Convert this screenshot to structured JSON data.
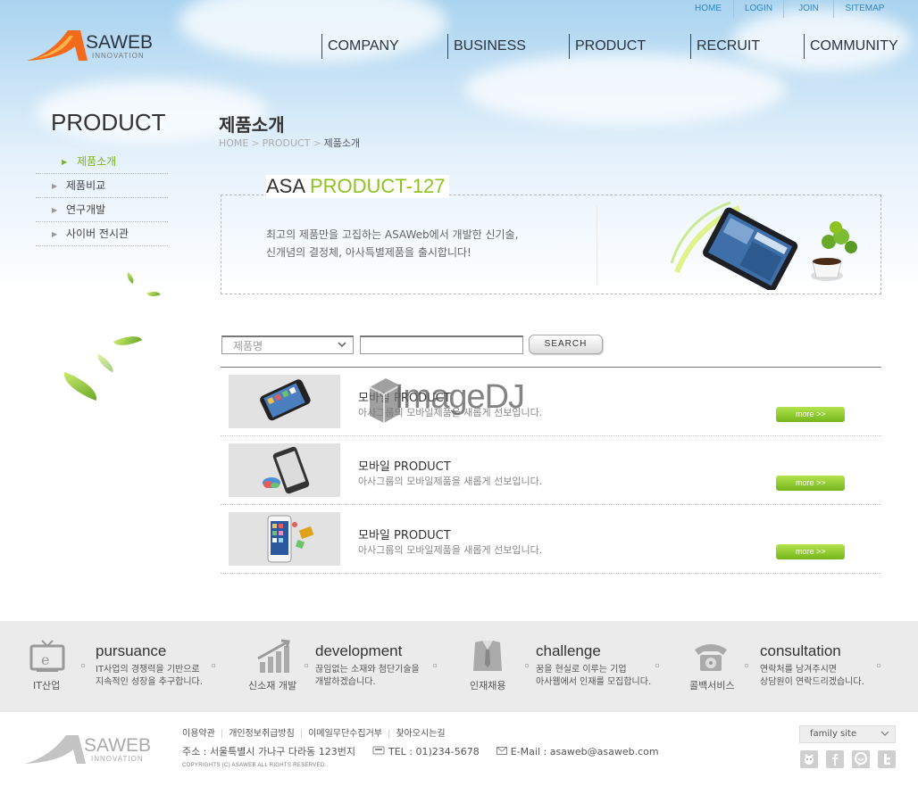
{
  "topnav": {
    "home": "HOME",
    "login": "LOGIN",
    "join": "JOIN",
    "sitemap": "SITEMAP"
  },
  "logo": {
    "brand": "SAWEB",
    "sub": "INNOVATION"
  },
  "mainnav": {
    "company": "COMPANY",
    "business": "BUSINESS",
    "product": "PRODUCT",
    "recruit": "RECRUIT",
    "community": "COMMUNITY"
  },
  "sidebar": {
    "title": "PRODUCT",
    "items": [
      {
        "label": "제품소개"
      },
      {
        "label": "제품비교"
      },
      {
        "label": "연구개발"
      },
      {
        "label": "사이버 전시관"
      }
    ]
  },
  "page": {
    "title": "제품소개",
    "breadcrumb": {
      "home": "HOME",
      "section": "PRODUCT",
      "current": "제품소개"
    }
  },
  "promo": {
    "title_a": "ASA",
    "title_b": "PRODUCT-127",
    "line1": "최고의 제품만을 고집하는 ASAWeb에서 개발한 신기술,",
    "line2": "신개념의 결정체, 아사특별제품을 출시합니다!"
  },
  "search": {
    "select_value": "제품명",
    "button": "SEARCH"
  },
  "products": [
    {
      "name": "모바일 PRODUCT",
      "desc": "아사그룹의 모바일제품을 새롭게 선보입니다.",
      "more": "more >>"
    },
    {
      "name": "모바일 PRODUCT",
      "desc": "아사그룹의 모바일제품을 새롭게 선보입니다.",
      "more": "more >>"
    },
    {
      "name": "모바일 PRODUCT",
      "desc": "아사그룹의 모바일제품을 새롭게 선보입니다.",
      "more": "more >>"
    }
  ],
  "watermark": "ImageDJ",
  "features": [
    {
      "label": "IT산업",
      "title": "pursuance",
      "desc1": "IT사업의 경쟁력을 기반으로",
      "desc2": "지속적인 성장을 추구합니다.",
      "icon": "tv-icon"
    },
    {
      "label": "신소재 개발",
      "title": "development",
      "desc1": "끊임없는 소재와 첨단기술을",
      "desc2": "개발하겠습니다.",
      "icon": "growth-chart-icon"
    },
    {
      "label": "인재채용",
      "title": "challenge",
      "desc1": "꿈을 현실로 이루는 기업",
      "desc2": "아사웹에서 인재를 모집합니다.",
      "icon": "business-shirt-icon"
    },
    {
      "label": "콜백서비스",
      "title": "consultation",
      "desc1": "연락처를 남겨주시면",
      "desc2": "상담원이 연락드리겠습니다.",
      "icon": "telephone-icon"
    }
  ],
  "footer": {
    "links": [
      "이용약관",
      "개인정보취급방침",
      "이메일무단수집거부",
      "찾아오시는길"
    ],
    "address": "주소 : 서울특별시 가나구 다라동 123번지",
    "tel": "TEL : 01)234-5678",
    "email": "E-Mail : asaweb@asaweb.com",
    "copyright": "COPYRIGHTS (C) ASAWEB ALL RIGHTS RESERVED.",
    "family_site": "family site"
  },
  "colors": {
    "accent_green": "#8dc21f",
    "nav_blue": "#2e86c1",
    "logo_orange": "#f26b1d"
  }
}
